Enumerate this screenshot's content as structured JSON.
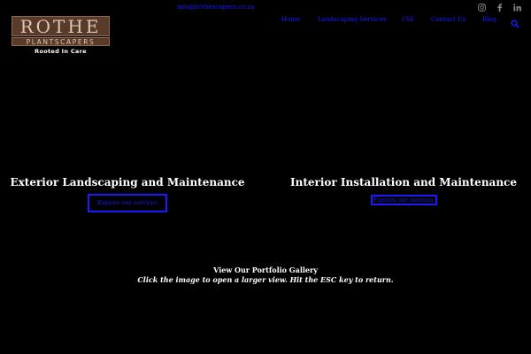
{
  "topbar": {
    "email": "info@rothescapers.co.za"
  },
  "social": [
    {
      "icon": "instagram-icon"
    },
    {
      "icon": "facebook-icon"
    },
    {
      "icon": "linkedin-icon"
    }
  ],
  "logo": {
    "name": "ROTHE",
    "sub": "PLANTSCAPERS",
    "tagline": "Rooted In Care"
  },
  "nav": {
    "items": [
      {
        "label": "Home"
      },
      {
        "label": "Landscaping Services"
      },
      {
        "label": "CSI"
      },
      {
        "label": "Contact Us"
      },
      {
        "label": "Blog"
      }
    ],
    "search_icon": "search-icon"
  },
  "services": [
    {
      "title": "Exterior Landscaping and Maintenance",
      "button": "Explore our services"
    },
    {
      "title": "Interior Installation and Maintenance",
      "button": "Explore our services"
    }
  ],
  "gallery": {
    "title": "View Our Portfolio Gallery",
    "hint": "Click the image to open a larger view. Hit the ESC key to return."
  },
  "colors": {
    "background": "#000000",
    "link": "#1a1aff",
    "logo_bg": "#5a3a28"
  }
}
